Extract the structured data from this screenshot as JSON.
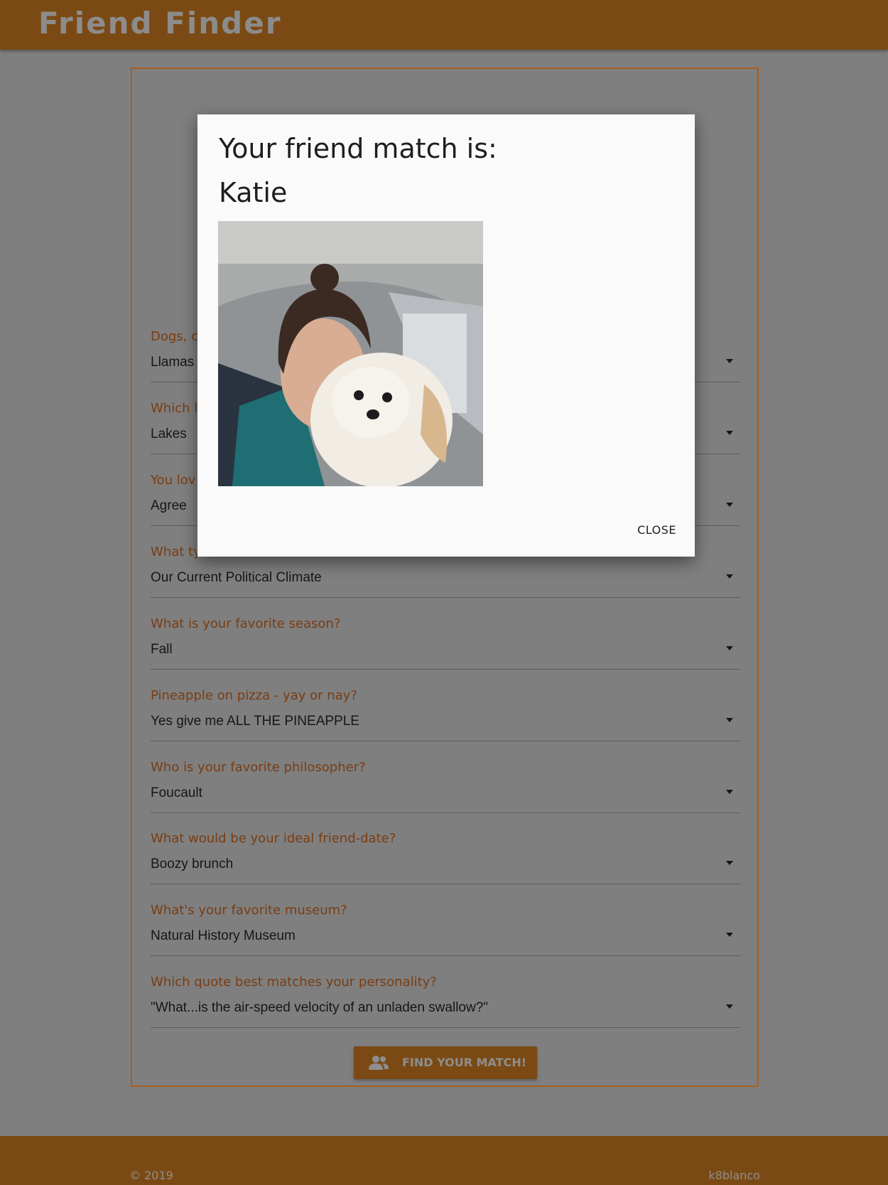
{
  "header": {
    "brand": "Friend Finder"
  },
  "form": {
    "questions": [
      {
        "label": "Dogs, c",
        "value": "Llamas"
      },
      {
        "label": "Which l",
        "value": "Lakes"
      },
      {
        "label": "You lov",
        "value": "Agree"
      },
      {
        "label": "What ty",
        "value": "Our Current Political Climate"
      },
      {
        "label": "What is your favorite season?",
        "value": "Fall"
      },
      {
        "label": "Pineapple on pizza - yay or nay?",
        "value": "Yes give me ALL THE PINEAPPLE"
      },
      {
        "label": "Who is your favorite philosopher?",
        "value": "Foucault"
      },
      {
        "label": "What would be your ideal friend-date?",
        "value": "Boozy brunch"
      },
      {
        "label": "What's your favorite museum?",
        "value": "Natural History Museum"
      },
      {
        "label": "Which quote best matches your personality?",
        "value": "\"What...is the air-speed velocity of an unladen swallow?\""
      }
    ],
    "submit_label": "FIND YOUR MATCH!",
    "submit_icon": "users-icon"
  },
  "modal": {
    "title": "Your friend match is:",
    "name": "Katie",
    "close_label": "CLOSE"
  },
  "footer": {
    "copyright": "© 2019",
    "author": "k8blanco"
  },
  "colors": {
    "brand": "#7b4a14",
    "accent": "#a85e1d",
    "overlay": "#7f7f7f"
  }
}
